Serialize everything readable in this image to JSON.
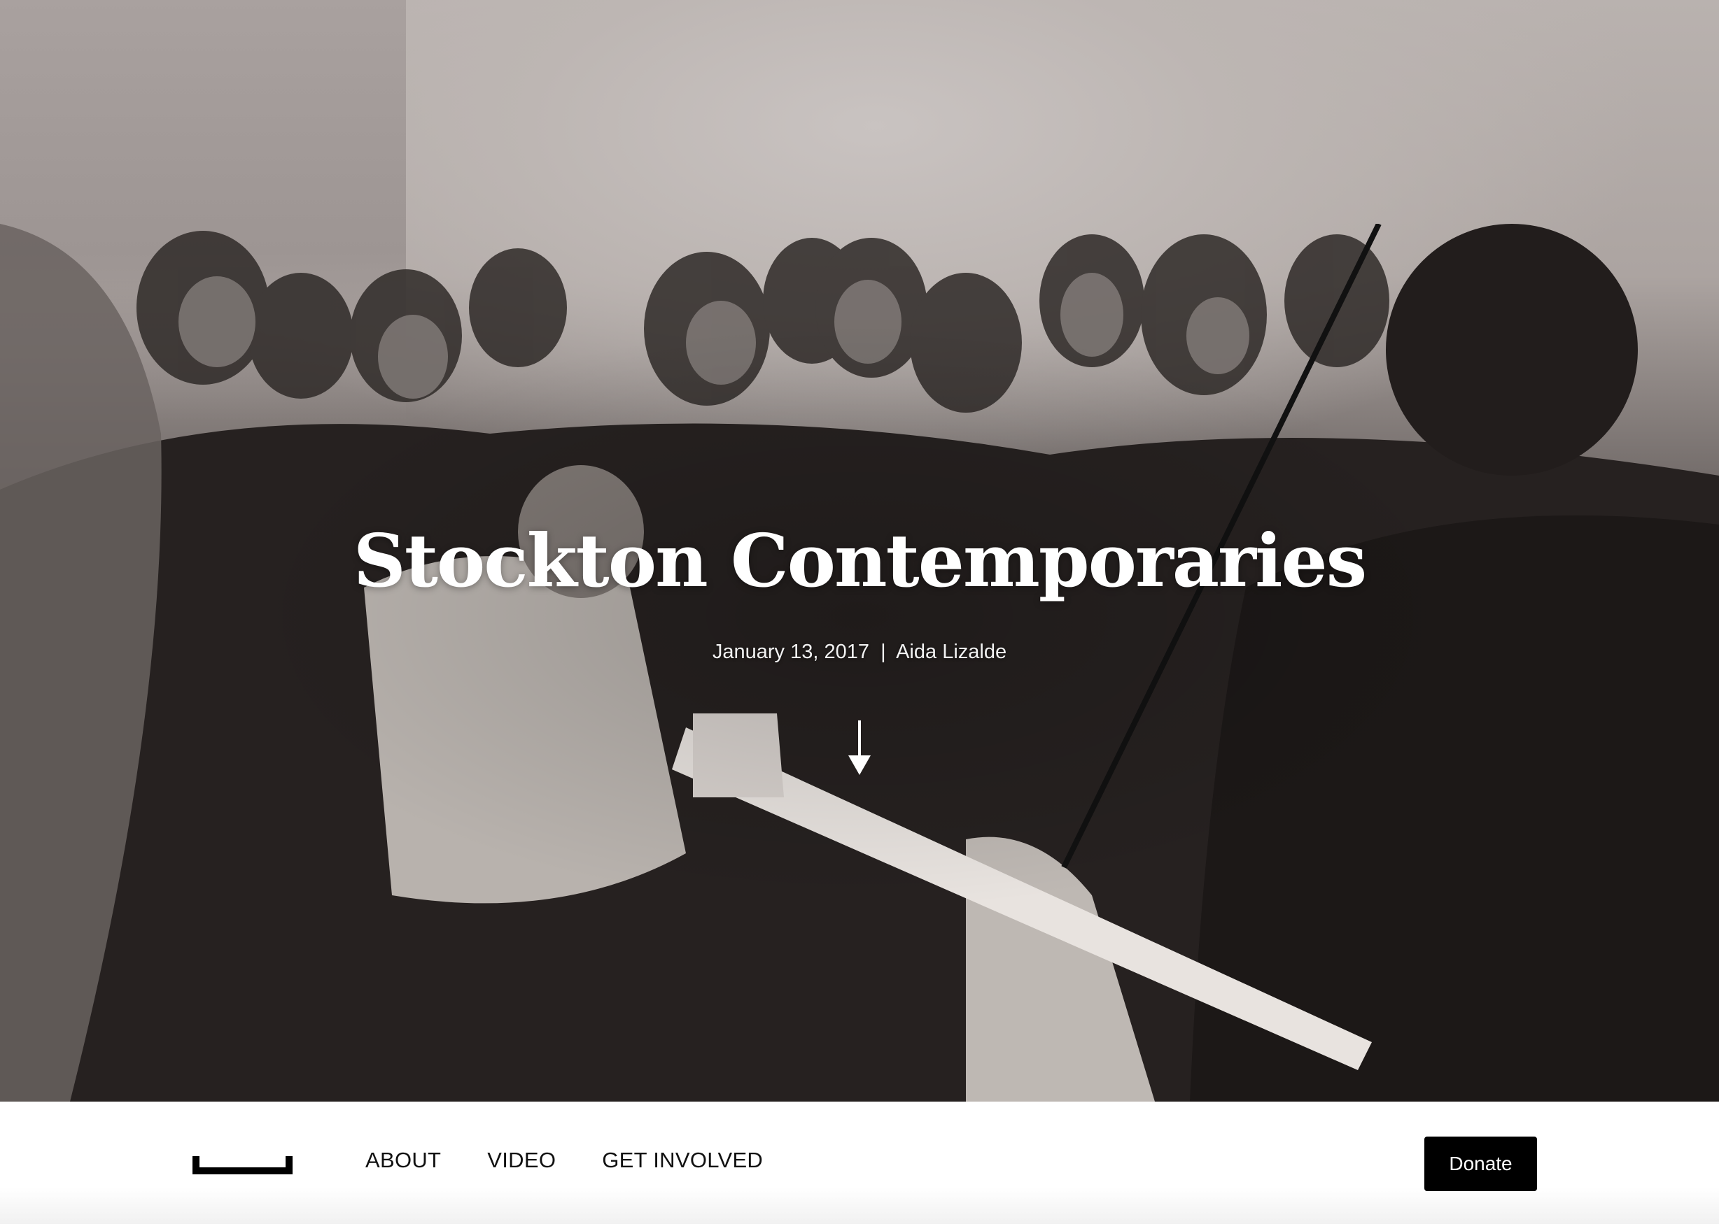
{
  "hero": {
    "title": "Stockton Contemporaries",
    "date": "January 13, 2017",
    "separator": "|",
    "author": "Aida Lizalde",
    "scroll_icon": "down-arrow-icon"
  },
  "nav": {
    "logo_icon": "bracket-logo-icon",
    "links": [
      "ABOUT",
      "VIDEO",
      "GET INVOLVED"
    ],
    "donate_label": "Donate"
  },
  "colors": {
    "title_text": "#ffffff",
    "donate_bg": "#000000",
    "donate_text": "#ffffff",
    "nav_text": "#111111"
  }
}
